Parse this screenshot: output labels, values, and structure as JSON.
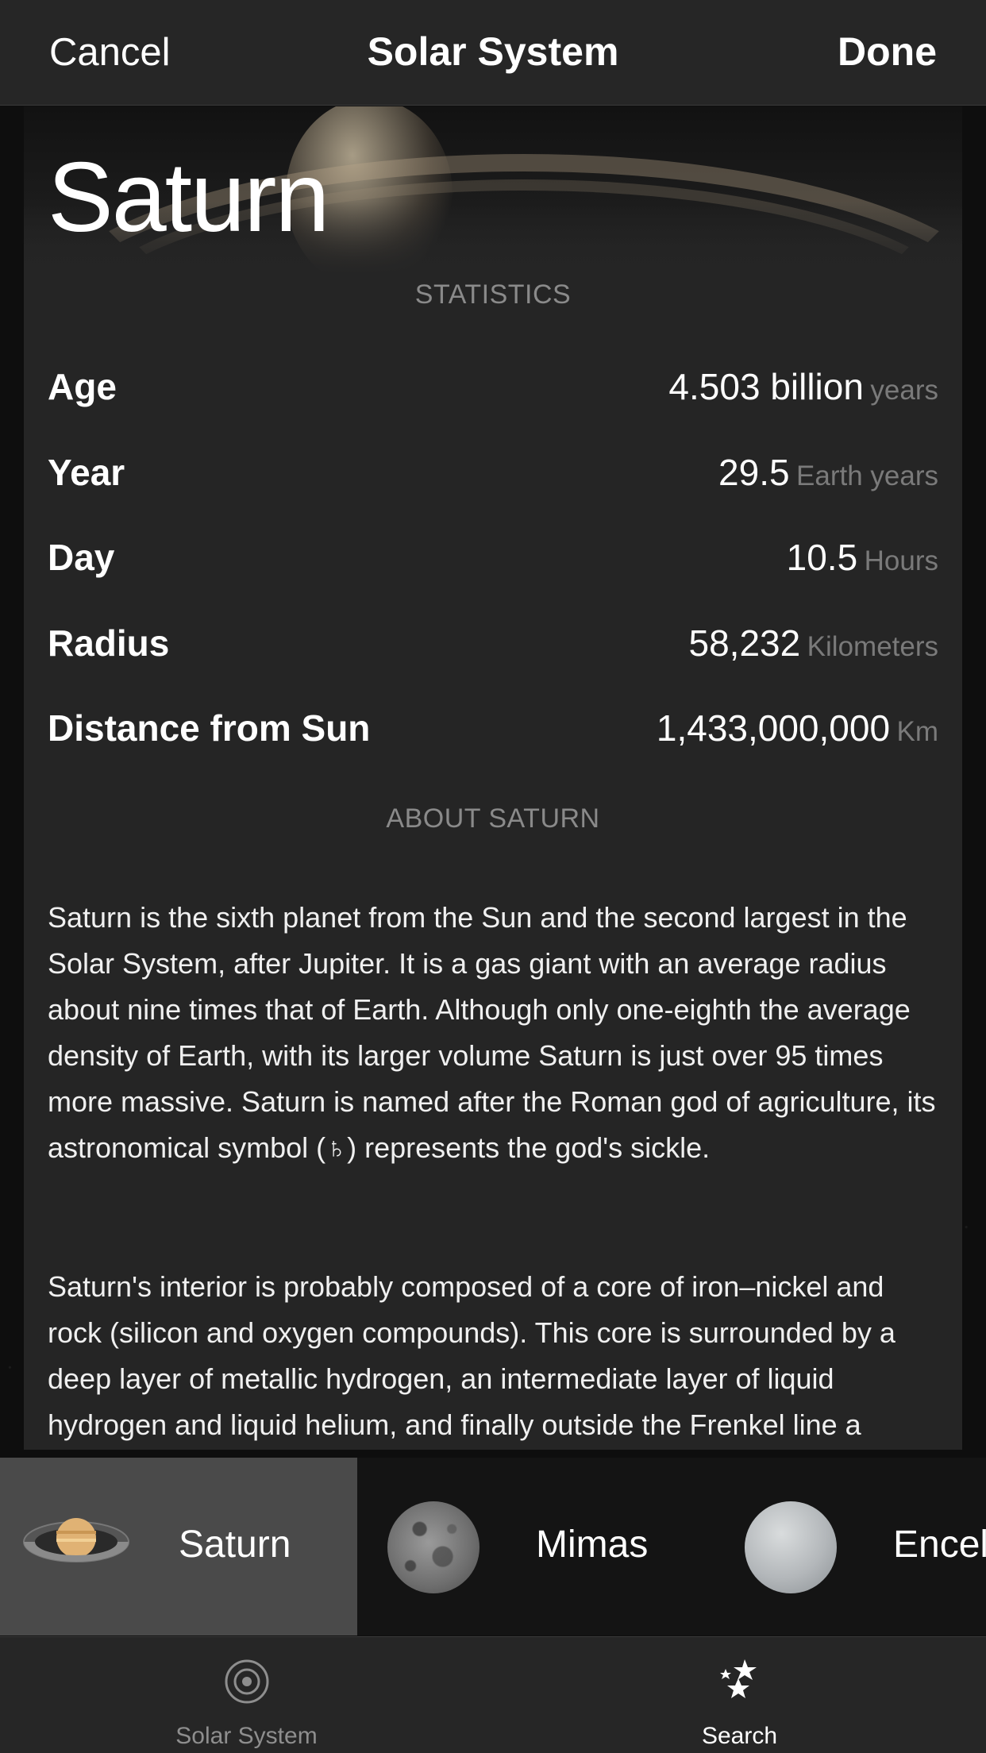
{
  "navbar": {
    "cancel_label": "Cancel",
    "title": "Solar System",
    "done_label": "Done"
  },
  "planet": {
    "name": "Saturn"
  },
  "statistics": {
    "header": "STATISTICS",
    "rows": [
      {
        "label": "Age",
        "value": "4.503 billion",
        "unit": "years"
      },
      {
        "label": "Year",
        "value": "29.5",
        "unit": "Earth years"
      },
      {
        "label": "Day",
        "value": "10.5",
        "unit": "Hours"
      },
      {
        "label": "Radius",
        "value": "58,232",
        "unit": "Kilometers"
      },
      {
        "label": "Distance from Sun",
        "value": "1,433,000,000",
        "unit": "Km"
      }
    ]
  },
  "about": {
    "header": "ABOUT SATURN",
    "paragraphs": [
      "Saturn is the sixth planet from the Sun and the second largest in the Solar System, after Jupiter. It is a gas giant with an average radius about nine times that of Earth. Although only one-eighth the average density of Earth, with its larger volume Saturn is just over 95 times more massive. Saturn is named after the Roman god of agriculture, its astronomical symbol (♄) represents the god's sickle.",
      "Saturn's interior is probably composed of a core of iron–nickel and rock (silicon and oxygen compounds). This core is surrounded by a deep layer of metallic hydrogen, an intermediate layer of liquid hydrogen and liquid helium, and finally outside the Frenkel line a"
    ]
  },
  "carousel": {
    "items": [
      {
        "label": "Saturn",
        "selected": true,
        "icon": "saturn-thumbnail"
      },
      {
        "label": "Mimas",
        "selected": false,
        "icon": "mimas-thumbnail"
      },
      {
        "label": "Enceladus",
        "selected": false,
        "icon": "enceladus-thumbnail"
      }
    ]
  },
  "tabbar": {
    "tabs": [
      {
        "label": "Solar System",
        "icon": "orbit-icon",
        "active": false,
        "color": "#8e8e8e"
      },
      {
        "label": "Search",
        "icon": "stars-icon",
        "active": true,
        "color": "#ffffff"
      }
    ]
  }
}
